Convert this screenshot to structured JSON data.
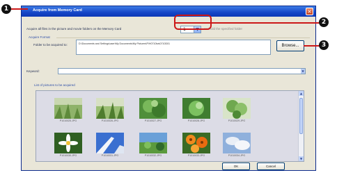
{
  "dialog": {
    "title": "Acquire from Memory Card",
    "close_glyph": "×"
  },
  "acquire": {
    "description": "Acquire all files in the picture and movie folders on the Memory Card",
    "folder_count_value": "1",
    "hint": "and fold the specified folder"
  },
  "format": {
    "group_label": "Acquire Format",
    "folder_label": "Folder to be acquired to:",
    "folder_path": "D:\\Documents and Settings\\user\\My Documents\\My Pictures\\P\\H0710ba\\0710D01",
    "browse_label": "Browse..."
  },
  "keyword": {
    "label": "Keyword:",
    "value": ""
  },
  "list": {
    "label": "List of pictures to be acquired",
    "items": [
      {
        "filename": "P1010025.JPG",
        "scene": "grass-field"
      },
      {
        "filename": "P1010026.JPG",
        "scene": "grass-field"
      },
      {
        "filename": "P1010027.JPG",
        "scene": "green-leaves"
      },
      {
        "filename": "P1010028.JPG",
        "scene": "green-leaves"
      },
      {
        "filename": "P1010029.JPG",
        "scene": "green-leaves"
      },
      {
        "filename": "P1010030.JPG",
        "scene": "white-flower"
      },
      {
        "filename": "P1010031.JPG",
        "scene": "blue-sky"
      },
      {
        "filename": "P1010032.JPG",
        "scene": "field-scene"
      },
      {
        "filename": "P1010033.JPG",
        "scene": "orange-flowers"
      },
      {
        "filename": "P1010034.JPG",
        "scene": "cloud-sky"
      }
    ]
  },
  "footer": {
    "ok_label": "OK",
    "cancel_label": "Cancel"
  },
  "callouts": [
    "1",
    "2",
    "3"
  ],
  "colors": {
    "titlebar": "#1646c7",
    "dialog_bg": "#e9e6d8",
    "callout_line": "#cc1717",
    "callout_badge": "#111111"
  }
}
